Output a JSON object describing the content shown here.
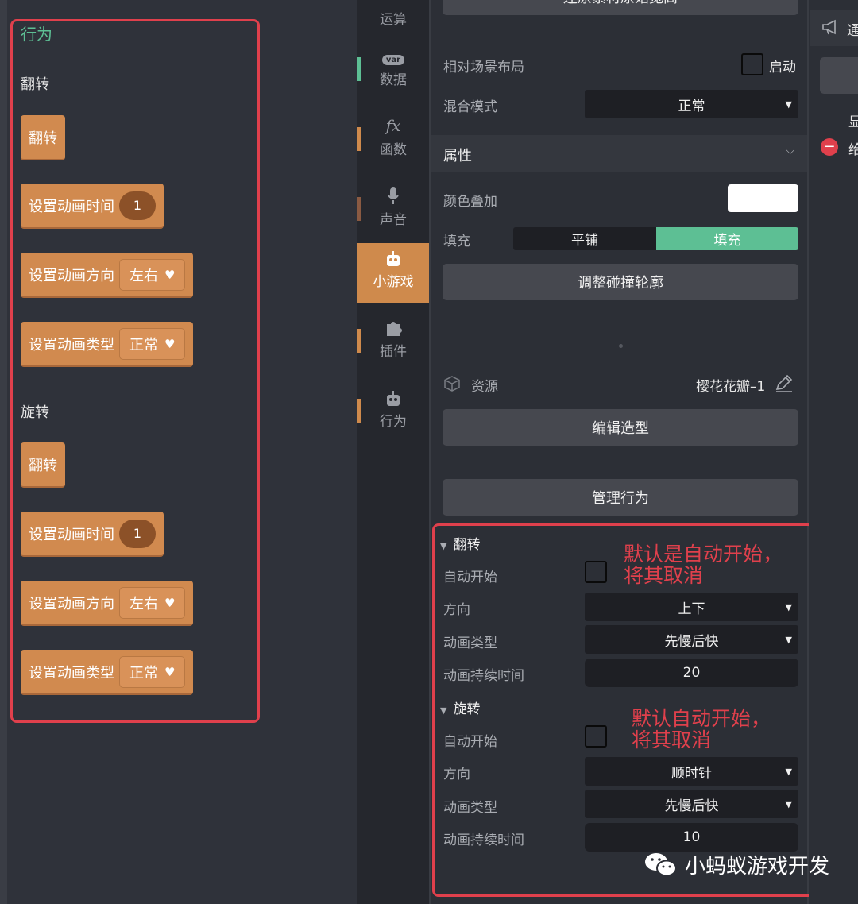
{
  "palette": {
    "title": "行为",
    "flip_section": {
      "heading": "翻转",
      "blocks": {
        "flip": "翻转",
        "time_label": "设置动画时间",
        "time_value": "1",
        "direction_label": "设置动画方向",
        "direction_value": "左右",
        "type_label": "设置动画类型",
        "type_value": "正常"
      }
    },
    "rotate_section": {
      "heading": "旋转",
      "blocks": {
        "flip": "翻转",
        "time_label": "设置动画时间",
        "time_value": "1",
        "direction_label": "设置动画方向",
        "direction_value": "左右",
        "type_label": "设置动画类型",
        "type_value": "正常"
      }
    },
    "dropdown_glyph": "♥"
  },
  "categories": [
    {
      "label": "运算",
      "icon": "operator-icon"
    },
    {
      "label": "数据",
      "icon": "var-icon",
      "badge": "var"
    },
    {
      "label": "函数",
      "icon": "function-icon",
      "glyph": "fx"
    },
    {
      "label": "声音",
      "icon": "microphone-icon"
    },
    {
      "label": "小游戏",
      "icon": "robot-icon",
      "active": true
    },
    {
      "label": "插件",
      "icon": "puzzle-icon"
    },
    {
      "label": "行为",
      "icon": "robot-icon"
    }
  ],
  "props": {
    "top_button": "还原素材原始宽高",
    "relative_layout_label": "相对场景布局",
    "relative_layout_check_label": "启动",
    "blend_mode_label": "混合模式",
    "blend_mode_value": "正常",
    "attributes_header": "属性",
    "color_overlay_label": "颜色叠加",
    "color_overlay_value": "#ffffff",
    "fill_label": "填充",
    "fill_options": [
      "平铺",
      "填充"
    ],
    "fill_selected": "填充",
    "collision_button": "调整碰撞轮廓",
    "resource_label": "资源",
    "resource_value": "樱花花瓣–1",
    "edit_shape_button": "编辑造型",
    "manage_behavior_button": "管理行为",
    "flip_behavior": {
      "title": "翻转",
      "autostart_label": "自动开始",
      "direction_label": "方向",
      "direction_value": "上下",
      "anim_type_label": "动画类型",
      "anim_type_value": "先慢后快",
      "duration_label": "动画持续时间",
      "duration_value": "20",
      "annotation_line1": "默认是自动开始，",
      "annotation_line2": "将其取消"
    },
    "rotate_behavior": {
      "title": "旋转",
      "autostart_label": "自动开始",
      "direction_label": "方向",
      "direction_value": "顺时针",
      "anim_type_label": "动画类型",
      "anim_type_value": "先慢后快",
      "duration_label": "动画持续时间",
      "duration_value": "10",
      "annotation_line1": "默认自动开始，",
      "annotation_line2": "将其取消"
    }
  },
  "right_panel": {
    "header_fragment": "通",
    "row1_fragment": "显",
    "row2_fragment": "给"
  },
  "watermark": "小蚂蚁游戏开发",
  "colors": {
    "accent_green": "#5dbf94",
    "block_orange": "#d18a4f",
    "annotation_red": "#e0404c"
  }
}
